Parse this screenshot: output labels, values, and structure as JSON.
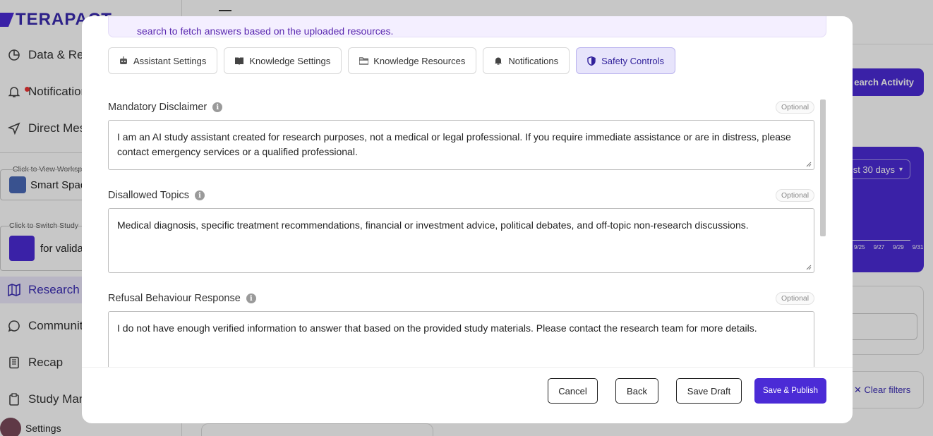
{
  "app": {
    "logo_text": "TERAPACT",
    "nav": {
      "data": "Data & Re",
      "notifications": "Notification",
      "direct": "Direct Mes",
      "research": "Research A",
      "community": "Community",
      "recap": "Recap",
      "study": "Study Man",
      "settings": "Settings"
    },
    "workspace_label": "Click to View Workspa",
    "workspace_name": "Smart Spac",
    "study_label": "Click to Switch Study",
    "study_name": "for validat",
    "bg_button": "earch Activity",
    "bg_select": "st 30 days",
    "bg_ticks": [
      "9/25",
      "9/27",
      "9/29",
      "9/31"
    ],
    "clear_filters": "Clear filters"
  },
  "modal": {
    "banner_text": "search to fetch answers based on the uploaded resources.",
    "tabs": [
      {
        "label": "Assistant Settings",
        "icon": "robot-icon"
      },
      {
        "label": "Knowledge Settings",
        "icon": "book-icon"
      },
      {
        "label": "Knowledge Resources",
        "icon": "folder-icon"
      },
      {
        "label": "Notifications",
        "icon": "bell-icon"
      },
      {
        "label": "Safety Controls",
        "icon": "shield-icon",
        "active": true
      }
    ],
    "fields": {
      "disclaimer": {
        "label": "Mandatory Disclaimer",
        "badge": "Optional",
        "value": "I am an AI study assistant created for research purposes, not a medical or legal professional. If you require immediate assistance or are in distress, please contact emergency services or a qualified professional."
      },
      "topics": {
        "label": "Disallowed Topics",
        "badge": "Optional",
        "value": "Medical diagnosis, specific treatment recommendations, financial or investment advice, political debates, and off-topic non-research discussions."
      },
      "refusal": {
        "label": "Refusal Behaviour Response",
        "badge": "Optional",
        "value": "I do not have enough verified information to answer that based on the provided study materials. Please contact the research team for more details."
      }
    },
    "info_glyph": "i",
    "buttons": {
      "cancel": "Cancel",
      "back": "Back",
      "save_draft": "Save Draft",
      "publish": "Save & Publish"
    },
    "colors": {
      "primary": "#4b2bd6",
      "active_tab_bg": "#e7e4fb"
    }
  }
}
